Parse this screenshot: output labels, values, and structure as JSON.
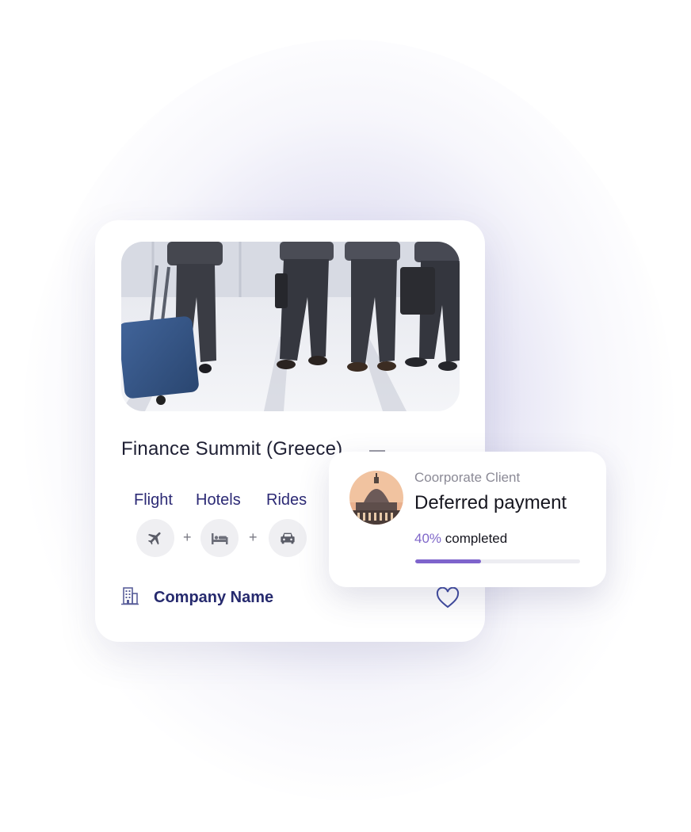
{
  "event": {
    "title": "Finance Summit (Greece)",
    "image": "business-travelers-walking-with-luggage"
  },
  "services": [
    {
      "label": "Flight",
      "icon": "airplane-icon"
    },
    {
      "label": "Hotels",
      "icon": "bed-icon"
    },
    {
      "label": "Rides",
      "icon": "car-icon"
    }
  ],
  "separator": "+",
  "company": {
    "name": "Company Name",
    "icon": "building-icon",
    "favorite_icon": "heart-icon"
  },
  "payment_card": {
    "client_label": "Coorporate Client",
    "title": "Deferred payment",
    "progress_percent_label": "40%",
    "progress_suffix": "completed",
    "progress_value": 0.4,
    "avatar": "st-peters-basilica-dome"
  },
  "colors": {
    "accent": "#7e64cc",
    "navy": "#262a6e",
    "icon_gray": "#7a7a84"
  }
}
